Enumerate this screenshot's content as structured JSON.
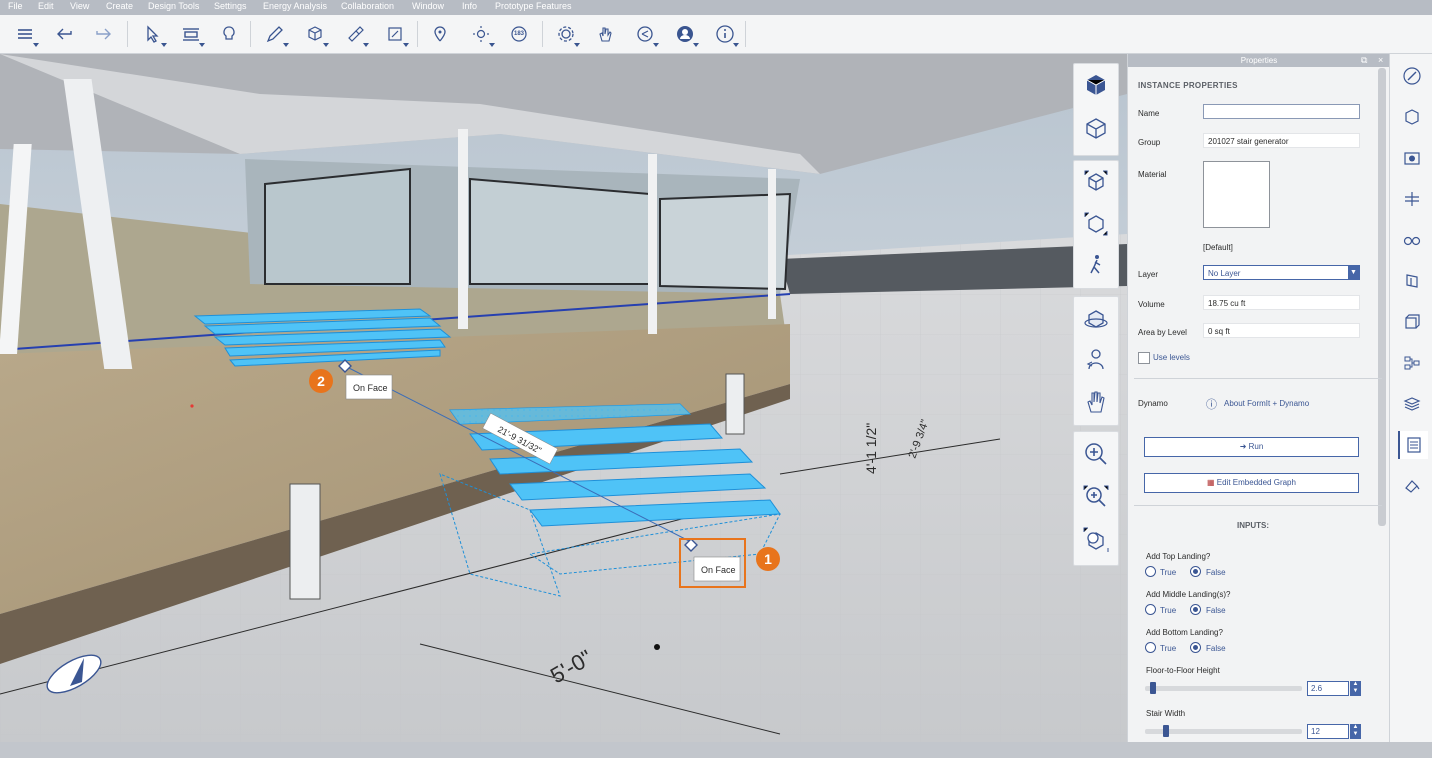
{
  "menu": [
    "File",
    "Edit",
    "View",
    "Create",
    "Design Tools",
    "Settings",
    "Energy Analysis",
    "Collaboration",
    "Window",
    "Info",
    "Prototype Features"
  ],
  "toolbar_icons": [
    "layers-icon",
    "undo-icon",
    "redo-icon",
    "select-icon",
    "align-icon",
    "help-bulb-icon",
    "draw-icon",
    "solid-add-icon",
    "paint-icon",
    "frame-icon",
    "location-icon",
    "sun-icon",
    "counter-icon",
    "settings-gear-icon",
    "hand-gesture-icon",
    "share-icon",
    "user-icon",
    "info-icon"
  ],
  "counter_value": "183",
  "viewport": {
    "dimension_label": "21'-9 31/32\"",
    "dim_5ft": "5'-0\"",
    "dim_4ft": "4'-1 1/2\"",
    "dim_side": "2'-9 3/4\"",
    "tooltip_1": "On Face",
    "tooltip_2": "On Face",
    "marker_1": "1",
    "marker_2": "2"
  },
  "nav_icons": [
    "view-cube-icon",
    "isometric-icon",
    "orbit-3d-icon",
    "rotate-3d-icon",
    "walk-icon",
    "orbit-icon",
    "look-around-icon",
    "pan-hand-icon",
    "zoom-icon",
    "zoom-in-icon",
    "zoom-extents-icon"
  ],
  "properties": {
    "title": "Properties",
    "section": "INSTANCE PROPERTIES",
    "name_label": "Name",
    "name_value": "",
    "group_label": "Group",
    "group_value": "201027 stair generator",
    "material_label": "Material",
    "material_value": "[Default]",
    "layer_label": "Layer",
    "layer_value": "No Layer",
    "volume_label": "Volume",
    "volume_value": "18.75 cu ft",
    "area_label": "Area by Level",
    "area_value": "0 sq ft",
    "use_levels": "Use levels",
    "dynamo_label": "Dynamo",
    "dynamo_link": "About FormIt + Dynamo",
    "run_label": "Run",
    "edit_graph_label": "Edit Embedded Graph",
    "inputs_title": "INPUTS:",
    "inputs": [
      {
        "label": "Add Top Landing?",
        "true_label": "True",
        "false_label": "False",
        "selected": "False"
      },
      {
        "label": "Add Middle Landing(s)?",
        "true_label": "True",
        "false_label": "False",
        "selected": "False"
      },
      {
        "label": "Add Bottom Landing?",
        "true_label": "True",
        "false_label": "False",
        "selected": "False"
      }
    ],
    "floor_height_label": "Floor-to-Floor Height",
    "floor_height_value": "2.6",
    "stair_width_label": "Stair Width",
    "stair_width_value": "12"
  },
  "right_icons": [
    "brush-icon",
    "materials-icon",
    "scenes-icon",
    "levels-icon",
    "glasses-icon",
    "groups-icon",
    "components-icon",
    "layers-tree-icon",
    "layers-icon",
    "properties-icon",
    "paint-bucket-icon"
  ],
  "colors": {
    "accent": "#3b5693",
    "selection": "#4fc3f7",
    "callout": "#e8741c"
  }
}
